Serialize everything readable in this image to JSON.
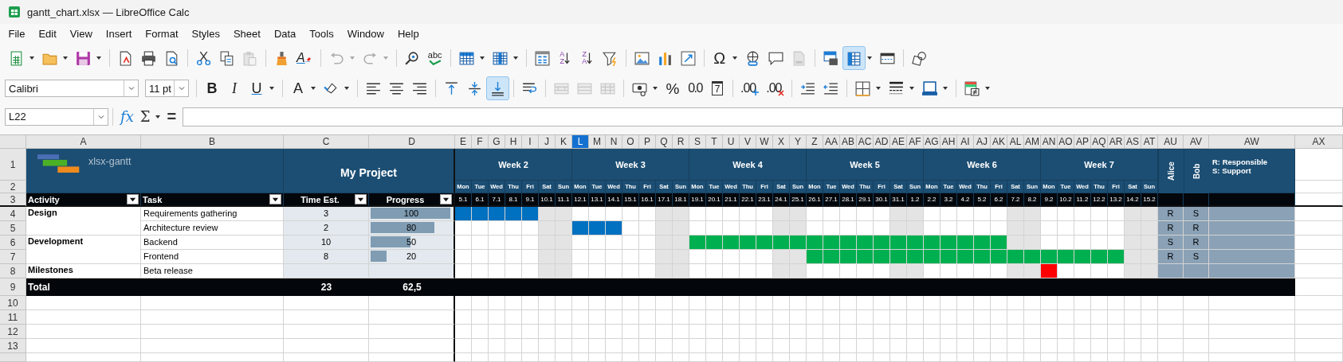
{
  "window": {
    "title": "gantt_chart.xlsx — LibreOffice Calc"
  },
  "menu": [
    "File",
    "Edit",
    "View",
    "Insert",
    "Format",
    "Styles",
    "Sheet",
    "Data",
    "Tools",
    "Window",
    "Help"
  ],
  "toolbars": [
    {
      "items": [
        {
          "kind": "new",
          "dropdown": true,
          "on": false,
          "disabled": false
        },
        {
          "kind": "open",
          "dropdown": true,
          "on": false,
          "disabled": false
        },
        {
          "kind": "save",
          "dropdown": true,
          "on": false,
          "disabled": false
        },
        {
          "kind": "separator"
        },
        {
          "kind": "export-pdf",
          "on": false,
          "disabled": false
        },
        {
          "kind": "print",
          "on": false,
          "disabled": false
        },
        {
          "kind": "print-preview",
          "on": false,
          "disabled": false
        },
        {
          "kind": "separator"
        },
        {
          "kind": "cut",
          "on": false,
          "disabled": false
        },
        {
          "kind": "copy",
          "on": false,
          "disabled": false
        },
        {
          "kind": "paste",
          "on": false,
          "disabled": true
        },
        {
          "kind": "separator"
        },
        {
          "kind": "clone-formatting",
          "on": false,
          "disabled": false
        },
        {
          "kind": "clear-formatting",
          "glyph": "A",
          "on": false,
          "disabled": false
        },
        {
          "kind": "separator"
        },
        {
          "kind": "undo",
          "dropdown": true,
          "on": false,
          "disabled": true
        },
        {
          "kind": "redo",
          "dropdown": true,
          "on": false,
          "disabled": true
        },
        {
          "kind": "separator"
        },
        {
          "kind": "find-replace",
          "on": false,
          "disabled": false
        },
        {
          "kind": "spelling",
          "glyph": "abc",
          "on": false,
          "disabled": false
        },
        {
          "kind": "separator"
        },
        {
          "kind": "insert-row",
          "dropdown": true,
          "on": false,
          "disabled": false
        },
        {
          "kind": "insert-column",
          "dropdown": true,
          "on": false,
          "disabled": false
        },
        {
          "kind": "separator"
        },
        {
          "kind": "sort",
          "on": false,
          "disabled": false
        },
        {
          "kind": "sort-ascending",
          "glyph": "AZ",
          "on": false,
          "disabled": false
        },
        {
          "kind": "sort-descending",
          "glyph": "ZA",
          "on": false,
          "disabled": false
        },
        {
          "kind": "autofilter",
          "on": false,
          "disabled": false
        },
        {
          "kind": "separator"
        },
        {
          "kind": "image",
          "on": false,
          "disabled": false
        },
        {
          "kind": "chart",
          "on": false,
          "disabled": false
        },
        {
          "kind": "pivot-table",
          "on": false,
          "disabled": false
        },
        {
          "kind": "separator"
        },
        {
          "kind": "special-character",
          "glyph": "Ω",
          "dropdown": true,
          "on": false,
          "disabled": false
        },
        {
          "kind": "hyperlink",
          "on": false,
          "disabled": false
        },
        {
          "kind": "comment",
          "on": false,
          "disabled": false
        },
        {
          "kind": "header-footer",
          "on": false,
          "disabled": true
        },
        {
          "kind": "separator"
        },
        {
          "kind": "print-area",
          "on": false,
          "disabled": false
        },
        {
          "kind": "freeze",
          "dropdown": true,
          "on": true,
          "disabled": false
        },
        {
          "kind": "split-window",
          "on": false,
          "disabled": false
        },
        {
          "kind": "separator"
        },
        {
          "kind": "shapes",
          "on": false,
          "disabled": false
        }
      ]
    },
    {
      "items": [
        {
          "kind": "font-name",
          "value": "Calibri"
        },
        {
          "kind": "font-size",
          "value": "11 pt"
        },
        {
          "kind": "separator"
        },
        {
          "kind": "bold",
          "glyph": "B",
          "on": false,
          "disabled": false
        },
        {
          "kind": "italic",
          "glyph": "I",
          "on": false,
          "disabled": false
        },
        {
          "kind": "underline",
          "glyph": "U",
          "dropdown": true,
          "on": false,
          "disabled": false
        },
        {
          "kind": "separator"
        },
        {
          "kind": "font-color",
          "glyph": "A",
          "dropdown": true,
          "on": false,
          "disabled": false
        },
        {
          "kind": "highlight",
          "dropdown": true,
          "on": false,
          "disabled": false
        },
        {
          "kind": "separator"
        },
        {
          "kind": "align-left",
          "on": false,
          "disabled": false
        },
        {
          "kind": "align-center",
          "on": false,
          "disabled": false
        },
        {
          "kind": "align-right",
          "on": false,
          "disabled": false
        },
        {
          "kind": "separator"
        },
        {
          "kind": "align-top",
          "on": false,
          "disabled": false
        },
        {
          "kind": "align-middle",
          "on": false,
          "disabled": false
        },
        {
          "kind": "align-bottom",
          "on": true,
          "disabled": false
        },
        {
          "kind": "separator"
        },
        {
          "kind": "wrap-text",
          "on": false,
          "disabled": false
        },
        {
          "kind": "separator"
        },
        {
          "kind": "merge-center",
          "on": false,
          "disabled": true
        },
        {
          "kind": "merge",
          "on": false,
          "disabled": true
        },
        {
          "kind": "unmerge",
          "on": false,
          "disabled": true
        },
        {
          "kind": "separator"
        },
        {
          "kind": "currency",
          "dropdown": true,
          "on": false,
          "disabled": false
        },
        {
          "kind": "percent",
          "glyph": "%",
          "on": false,
          "disabled": false
        },
        {
          "kind": "number-format",
          "glyph": "0.0",
          "on": false,
          "disabled": false
        },
        {
          "kind": "date-format",
          "glyph": "7",
          "on": false,
          "disabled": false
        },
        {
          "kind": "separator"
        },
        {
          "kind": "add-decimal",
          "glyph": ".00",
          "on": false,
          "disabled": false
        },
        {
          "kind": "delete-decimal",
          "glyph": ".00",
          "on": false,
          "disabled": false
        },
        {
          "kind": "separator"
        },
        {
          "kind": "indent-increase",
          "on": false,
          "disabled": false
        },
        {
          "kind": "indent-decrease",
          "on": false,
          "disabled": false
        },
        {
          "kind": "separator"
        },
        {
          "kind": "borders",
          "dropdown": true,
          "on": false,
          "disabled": false
        },
        {
          "kind": "border-style",
          "dropdown": true,
          "on": false,
          "disabled": false
        },
        {
          "kind": "border-color",
          "dropdown": true,
          "on": false,
          "disabled": false
        },
        {
          "kind": "separator"
        },
        {
          "kind": "conditional",
          "dropdown": true,
          "on": false,
          "disabled": false
        }
      ]
    }
  ],
  "formula_bar": {
    "name_box": "L22",
    "buttons": [
      {
        "kind": "function-wizard",
        "glyph": "fx"
      },
      {
        "kind": "sum",
        "glyph": "Σ",
        "dropdown": true
      },
      {
        "kind": "formula",
        "glyph": "="
      }
    ]
  },
  "sheet": {
    "columns": [
      {
        "label": "A",
        "selected": false
      },
      {
        "label": "B",
        "selected": false
      },
      {
        "label": "C",
        "selected": false
      },
      {
        "label": "D",
        "selected": false
      },
      {
        "label": "E",
        "selected": false
      },
      {
        "label": "F",
        "selected": false
      },
      {
        "label": "G",
        "selected": false
      },
      {
        "label": "H",
        "selected": false
      },
      {
        "label": "I",
        "selected": false
      },
      {
        "label": "J",
        "selected": false
      },
      {
        "label": "K",
        "selected": false
      },
      {
        "label": "L",
        "selected": true
      },
      {
        "label": "M",
        "selected": false
      },
      {
        "label": "N",
        "selected": false
      },
      {
        "label": "O",
        "selected": false
      },
      {
        "label": "P",
        "selected": false
      },
      {
        "label": "Q",
        "selected": false
      },
      {
        "label": "R",
        "selected": false
      },
      {
        "label": "S",
        "selected": false
      },
      {
        "label": "T",
        "selected": false
      },
      {
        "label": "U",
        "selected": false
      },
      {
        "label": "V",
        "selected": false
      },
      {
        "label": "W",
        "selected": false
      },
      {
        "label": "X",
        "selected": false
      },
      {
        "label": "Y",
        "selected": false
      },
      {
        "label": "Z",
        "selected": false
      },
      {
        "label": "AA",
        "selected": false
      },
      {
        "label": "AB",
        "selected": false
      },
      {
        "label": "AC",
        "selected": false
      },
      {
        "label": "AD",
        "selected": false
      },
      {
        "label": "AE",
        "selected": false
      },
      {
        "label": "AF",
        "selected": false
      },
      {
        "label": "AG",
        "selected": false
      },
      {
        "label": "AH",
        "selected": false
      },
      {
        "label": "AI",
        "selected": false
      },
      {
        "label": "AJ",
        "selected": false
      },
      {
        "label": "AK",
        "selected": false
      },
      {
        "label": "AL",
        "selected": false
      },
      {
        "label": "AM",
        "selected": false
      },
      {
        "label": "AN",
        "selected": false
      },
      {
        "label": "AO",
        "selected": false
      },
      {
        "label": "AP",
        "selected": false
      },
      {
        "label": "AQ",
        "selected": false
      },
      {
        "label": "AR",
        "selected": false
      },
      {
        "label": "AS",
        "selected": false
      },
      {
        "label": "AT",
        "selected": false
      },
      {
        "label": "AU",
        "selected": false
      },
      {
        "label": "AV",
        "selected": false
      },
      {
        "label": "AW",
        "selected": false
      },
      {
        "label": "AX",
        "selected": false
      }
    ],
    "rows": [
      "1",
      "2",
      "3",
      "4",
      "5",
      "6",
      "7",
      "8",
      "9",
      "10",
      "11",
      "12",
      "13"
    ],
    "logo_text": "xlsx-gantt",
    "project_title": "My Project",
    "headers": [
      "Activity",
      "Task",
      "Time Est.",
      "Progress"
    ],
    "weeks": [
      "Week 2",
      "Week 3",
      "Week 4",
      "Week 5",
      "Week 6",
      "Week 7"
    ],
    "days": [
      {
        "name": "Mon",
        "date": "5.1",
        "weekend": false
      },
      {
        "name": "Tue",
        "date": "6.1",
        "weekend": false
      },
      {
        "name": "Wed",
        "date": "7.1",
        "weekend": false
      },
      {
        "name": "Thu",
        "date": "8.1",
        "weekend": false
      },
      {
        "name": "Fri",
        "date": "9.1",
        "weekend": false
      },
      {
        "name": "Sat",
        "date": "10.1",
        "weekend": true
      },
      {
        "name": "Sun",
        "date": "11.1",
        "weekend": true
      },
      {
        "name": "Mon",
        "date": "12.1",
        "weekend": false
      },
      {
        "name": "Tue",
        "date": "13.1",
        "weekend": false
      },
      {
        "name": "Wed",
        "date": "14.1",
        "weekend": false
      },
      {
        "name": "Thu",
        "date": "15.1",
        "weekend": false
      },
      {
        "name": "Fri",
        "date": "16.1",
        "weekend": false
      },
      {
        "name": "Sat",
        "date": "17.1",
        "weekend": true
      },
      {
        "name": "Sun",
        "date": "18.1",
        "weekend": true
      },
      {
        "name": "Mon",
        "date": "19.1",
        "weekend": false
      },
      {
        "name": "Tue",
        "date": "20.1",
        "weekend": false
      },
      {
        "name": "Wed",
        "date": "21.1",
        "weekend": false
      },
      {
        "name": "Thu",
        "date": "22.1",
        "weekend": false
      },
      {
        "name": "Fri",
        "date": "23.1",
        "weekend": false
      },
      {
        "name": "Sat",
        "date": "24.1",
        "weekend": true
      },
      {
        "name": "Sun",
        "date": "25.1",
        "weekend": true
      },
      {
        "name": "Mon",
        "date": "26.1",
        "weekend": false
      },
      {
        "name": "Tue",
        "date": "27.1",
        "weekend": false
      },
      {
        "name": "Wed",
        "date": "28.1",
        "weekend": false
      },
      {
        "name": "Thu",
        "date": "29.1",
        "weekend": false
      },
      {
        "name": "Fri",
        "date": "30.1",
        "weekend": false
      },
      {
        "name": "Sat",
        "date": "31.1",
        "weekend": true
      },
      {
        "name": "Sun",
        "date": "1.2",
        "weekend": true
      },
      {
        "name": "Mon",
        "date": "2.2",
        "weekend": false
      },
      {
        "name": "Tue",
        "date": "3.2",
        "weekend": false
      },
      {
        "name": "Wed",
        "date": "4.2",
        "weekend": false
      },
      {
        "name": "Thu",
        "date": "5.2",
        "weekend": false
      },
      {
        "name": "Fri",
        "date": "6.2",
        "weekend": false
      },
      {
        "name": "Sat",
        "date": "7.2",
        "weekend": true
      },
      {
        "name": "Sun",
        "date": "8.2",
        "weekend": true
      },
      {
        "name": "Mon",
        "date": "9.2",
        "weekend": false
      },
      {
        "name": "Tue",
        "date": "10.2",
        "weekend": false
      },
      {
        "name": "Wed",
        "date": "11.2",
        "weekend": false
      },
      {
        "name": "Thu",
        "date": "12.2",
        "weekend": false
      },
      {
        "name": "Fri",
        "date": "13.2",
        "weekend": false
      },
      {
        "name": "Sat",
        "date": "14.2",
        "weekend": true
      },
      {
        "name": "Sun",
        "date": "15.2",
        "weekend": true
      }
    ],
    "people": [
      "Alice",
      "Bob"
    ],
    "legend": [
      "R: Responsible",
      "S: Support"
    ],
    "activities": [
      {
        "name": "Design",
        "tasks": [
          {
            "name": "Requirements gathering",
            "time_est": "3",
            "progress": "100",
            "level": 1.0,
            "color": "#0070c0",
            "roles": [
              "R",
              "S"
            ],
            "schedule": [
              true,
              true,
              true,
              true,
              true,
              false,
              false,
              false,
              false,
              false,
              false,
              false,
              false,
              false,
              false,
              false,
              false,
              false,
              false,
              false,
              false,
              false,
              false,
              false,
              false,
              false,
              false,
              false,
              false,
              false,
              false,
              false,
              false,
              false,
              false,
              false,
              false,
              false,
              false,
              false,
              false,
              false
            ]
          },
          {
            "name": "Architecture review",
            "time_est": "2",
            "progress": "80",
            "level": 0.8,
            "color": "#0070c0",
            "roles": [
              "R",
              "R"
            ],
            "schedule": [
              false,
              false,
              false,
              false,
              false,
              false,
              false,
              true,
              true,
              true,
              false,
              false,
              false,
              false,
              false,
              false,
              false,
              false,
              false,
              false,
              false,
              false,
              false,
              false,
              false,
              false,
              false,
              false,
              false,
              false,
              false,
              false,
              false,
              false,
              false,
              false,
              false,
              false,
              false,
              false,
              false,
              false
            ]
          }
        ]
      },
      {
        "name": "Development",
        "tasks": [
          {
            "name": "Backend",
            "time_est": "10",
            "progress": "50",
            "level": 0.5,
            "color": "#00b050",
            "roles": [
              "S",
              "R"
            ],
            "schedule": [
              false,
              false,
              false,
              false,
              false,
              false,
              false,
              false,
              false,
              false,
              false,
              false,
              false,
              false,
              true,
              true,
              true,
              true,
              true,
              true,
              true,
              true,
              true,
              true,
              true,
              true,
              true,
              true,
              true,
              true,
              true,
              true,
              true,
              false,
              false,
              false,
              false,
              false,
              false,
              false,
              false,
              false
            ]
          },
          {
            "name": "Frontend",
            "time_est": "8",
            "progress": "20",
            "level": 0.2,
            "color": "#00b050",
            "roles": [
              "R",
              "S"
            ],
            "schedule": [
              false,
              false,
              false,
              false,
              false,
              false,
              false,
              false,
              false,
              false,
              false,
              false,
              false,
              false,
              false,
              false,
              false,
              false,
              false,
              false,
              false,
              true,
              true,
              true,
              true,
              true,
              true,
              true,
              true,
              true,
              true,
              true,
              true,
              true,
              true,
              true,
              true,
              true,
              true,
              true,
              false,
              false
            ]
          }
        ]
      },
      {
        "name": "Milestones",
        "tasks": [
          {
            "name": "Beta release",
            "color": "#ff0000",
            "schedule": [
              false,
              false,
              false,
              false,
              false,
              false,
              false,
              false,
              false,
              false,
              false,
              false,
              false,
              false,
              false,
              false,
              false,
              false,
              false,
              false,
              false,
              false,
              false,
              false,
              false,
              false,
              false,
              false,
              false,
              false,
              false,
              false,
              false,
              false,
              false,
              true,
              false,
              false,
              false,
              false,
              false,
              false
            ]
          }
        ]
      }
    ],
    "total": {
      "label": "Total",
      "time_est": "23",
      "progress": "62,5"
    }
  }
}
